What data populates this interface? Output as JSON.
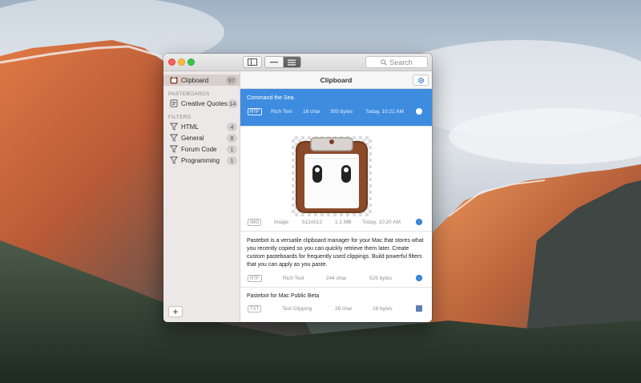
{
  "window": {
    "title": "Clipboard"
  },
  "toolbar": {
    "search_placeholder": "Search"
  },
  "sidebar": {
    "clipboard": {
      "label": "Clipboard",
      "count": "97"
    },
    "pasteboards_header": "PASTEBOARDS",
    "pasteboards": [
      {
        "label": "Creative Quotes",
        "count": "14"
      }
    ],
    "filters_header": "FILTERS",
    "filters": [
      {
        "label": "HTML",
        "count": "4"
      },
      {
        "label": "General",
        "count": "8"
      },
      {
        "label": "Forum Code",
        "count": "1"
      },
      {
        "label": "Programming",
        "count": "1"
      }
    ],
    "add_label": "+"
  },
  "clippings": [
    {
      "text": "Command the Sea.",
      "type": "RTF",
      "kind": "Rich Text",
      "chars": "16 char",
      "size": "305 bytes",
      "time": "Today, 10:21 AM"
    },
    {
      "type": "IMG",
      "kind": "Image",
      "dims": "512x512",
      "size": "1.1 MB",
      "time": "Today, 10:20 AM"
    },
    {
      "text": "Pastebot is a versatile clipboard manager for your Mac that stores what you recently copied so you can quickly retrieve them later. Create custom pasteboards for frequently used clippings. Build powerful filters that you can apply as you paste.",
      "type": "RTF",
      "kind": "Rich Text",
      "chars": "244 char",
      "size": "526 bytes"
    },
    {
      "text": "Pastebot for Mac Public Beta",
      "type": "TXT",
      "kind": "Text Clipping",
      "chars": "28 char",
      "size": "28 bytes"
    }
  ],
  "colors": {
    "selection": "#3d8ce0",
    "sidebar_bg": "#ece8e7"
  }
}
